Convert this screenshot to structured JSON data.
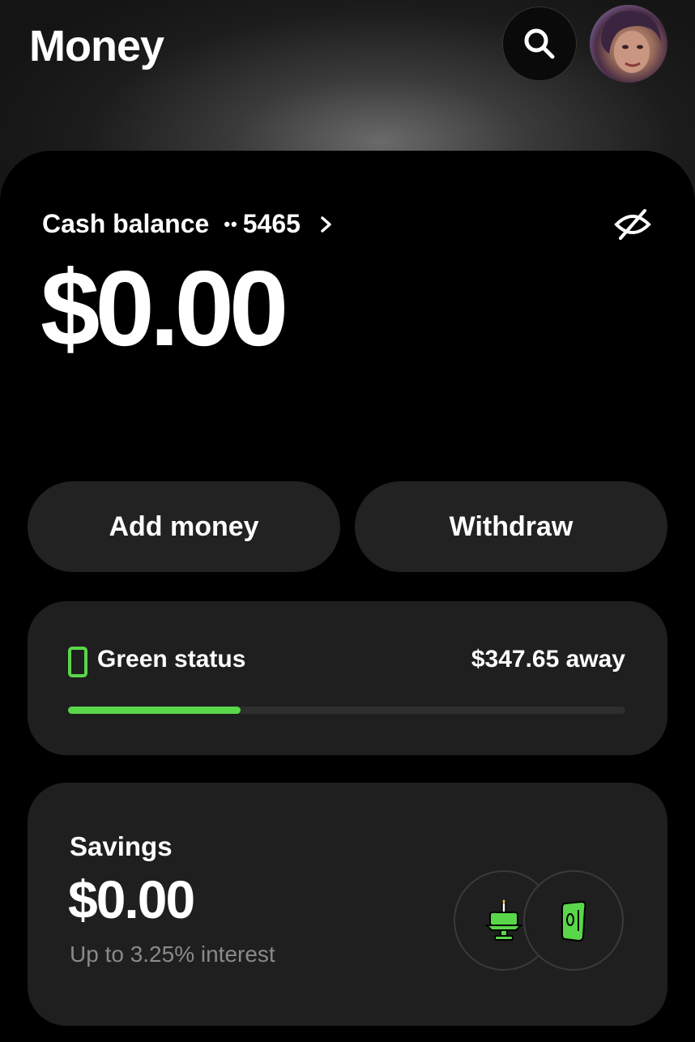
{
  "header": {
    "title": "Money",
    "search_icon": "search-icon",
    "avatar": "profile-avatar"
  },
  "cash": {
    "label": "Cash balance",
    "account_dots": "••",
    "account_last4": "5465",
    "chevron_icon": "chevron-right-icon",
    "hide_icon": "eye-off-icon",
    "balance": "$0.00"
  },
  "actions": {
    "add_money": "Add money",
    "withdraw": "Withdraw"
  },
  "status": {
    "label": "Green status",
    "away": "$347.65 away",
    "progress_fraction": 0.31,
    "accent_color": "#5ad64a"
  },
  "savings": {
    "label": "Savings",
    "amount": "$0.00",
    "subtext": "Up to 3.25% interest",
    "goal_icons": [
      "birthday-cake-icon",
      "money-roll-icon"
    ]
  }
}
